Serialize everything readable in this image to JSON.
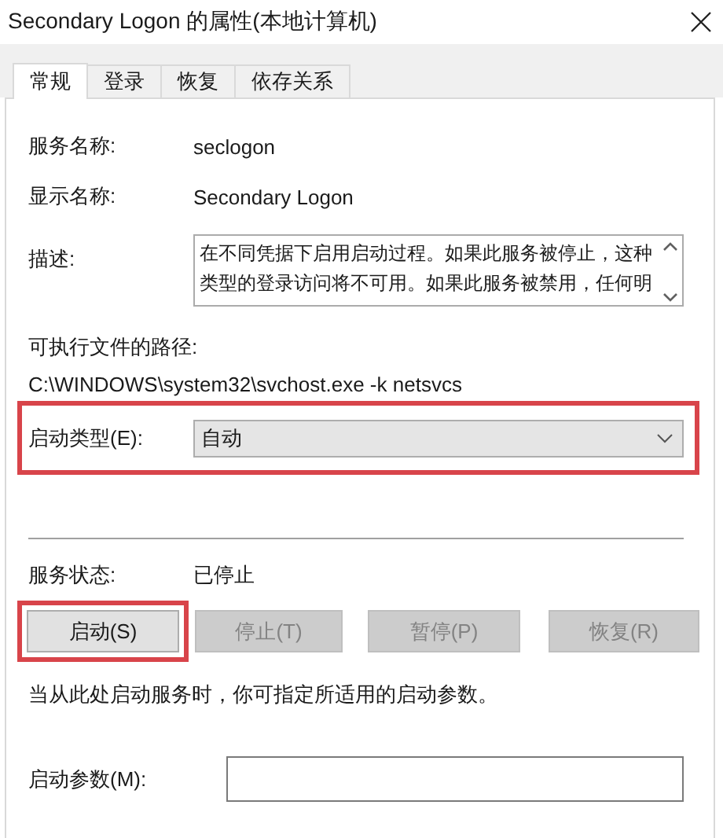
{
  "window": {
    "title": "Secondary Logon 的属性(本地计算机)"
  },
  "tabs": [
    {
      "label": "常规",
      "selected": true
    },
    {
      "label": "登录",
      "selected": false
    },
    {
      "label": "恢复",
      "selected": false
    },
    {
      "label": "依存关系",
      "selected": false
    }
  ],
  "service_name": {
    "label": "服务名称:",
    "value": "seclogon"
  },
  "display_name": {
    "label": "显示名称:",
    "value": "Secondary Logon"
  },
  "description": {
    "label": "描述:",
    "value": "在不同凭据下启用启动过程。如果此服务被停止，这种类型的登录访问将不可用。如果此服务被禁用，任何明"
  },
  "executable_path": {
    "label": "可执行文件的路径:",
    "value": "C:\\WINDOWS\\system32\\svchost.exe -k netsvcs"
  },
  "startup_type": {
    "label": "启动类型(E):",
    "value": "自动",
    "highlighted": true
  },
  "service_status": {
    "label": "服务状态:",
    "value": "已停止"
  },
  "buttons": [
    {
      "label": "启动(S)",
      "disabled": false,
      "highlighted": true
    },
    {
      "label": "停止(T)",
      "disabled": true,
      "highlighted": false
    },
    {
      "label": "暂停(P)",
      "disabled": true,
      "highlighted": false
    },
    {
      "label": "恢复(R)",
      "disabled": true,
      "highlighted": false
    }
  ],
  "note": "当从此处启动服务时，你可指定所适用的启动参数。",
  "start_parameters": {
    "label": "启动参数(M):"
  }
}
